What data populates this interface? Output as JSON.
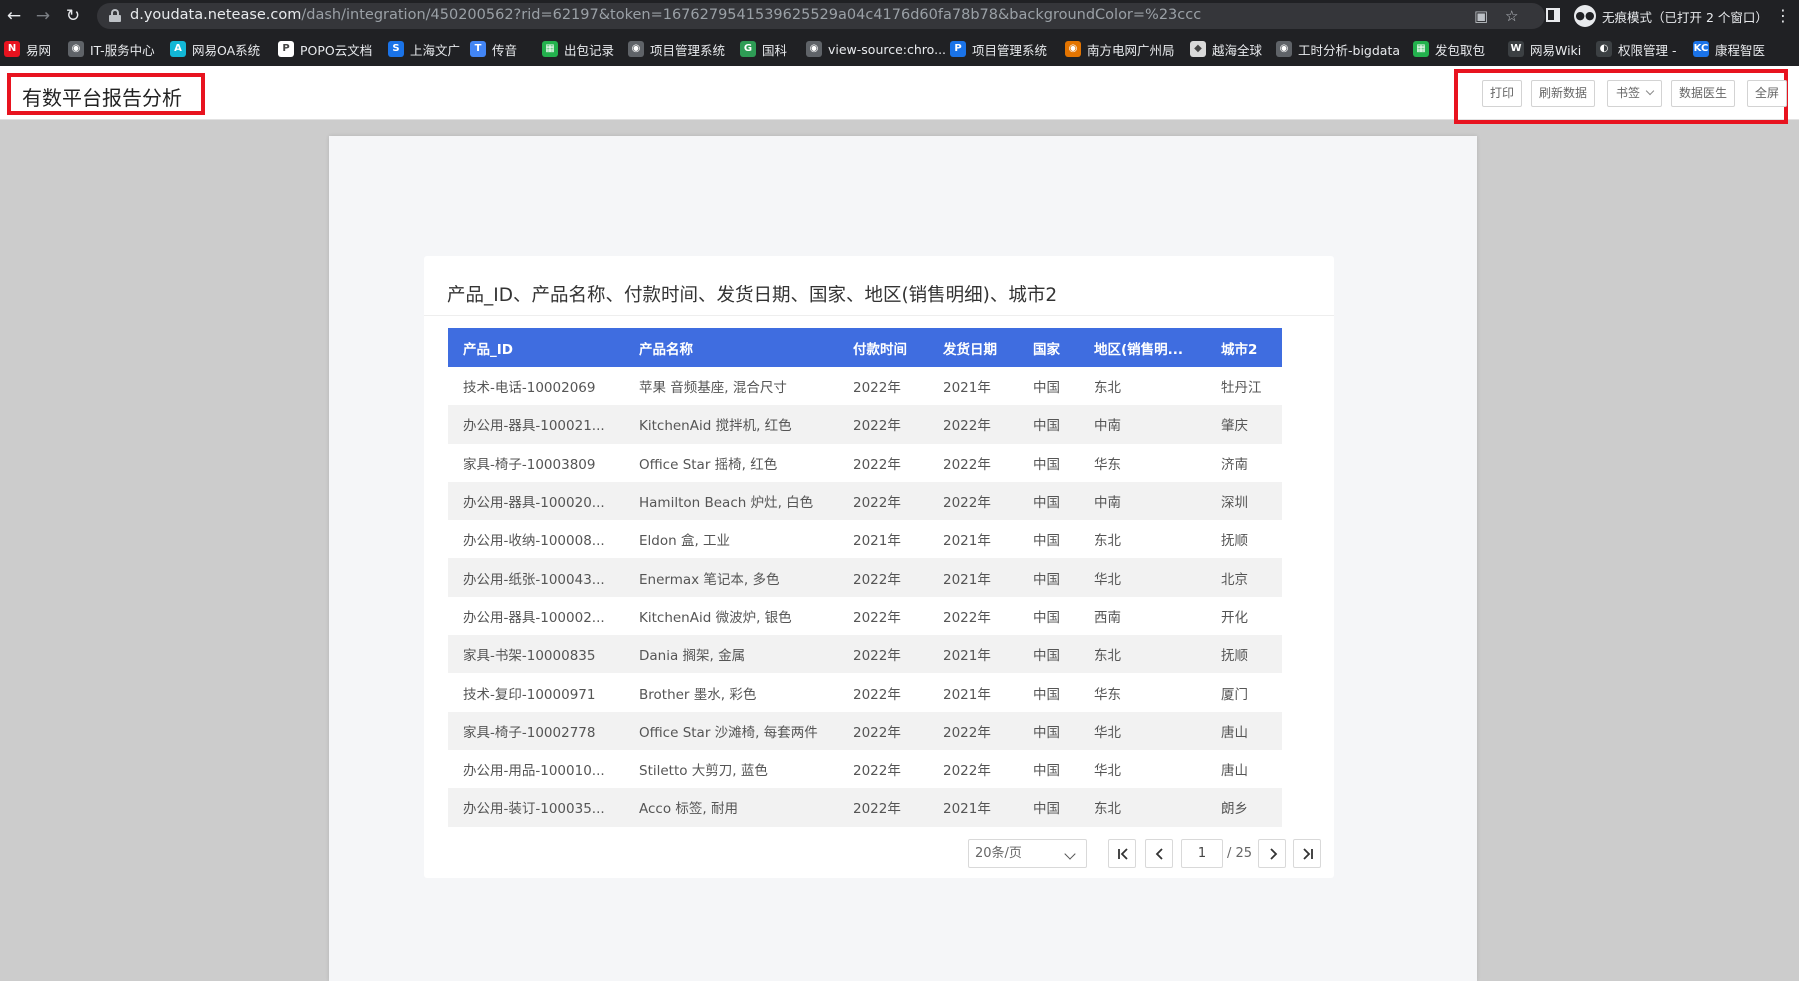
{
  "browser": {
    "url_host": "d.youdata.netease.com",
    "url_path": "/dash/integration/450200562?rid=62197&token=1676279541539625529a04c4176d60fa78b78&backgroundColor=%23ccc",
    "incognito_label": "无痕模式（已打开 2 个窗口）",
    "bookmarks": [
      {
        "label": "易网",
        "icon": "netease-icon",
        "color": "#e8131f",
        "glyph": "N"
      },
      {
        "label": "IT-服务中心",
        "icon": "globe-icon",
        "color": "#5f6368",
        "glyph": "◉"
      },
      {
        "label": "网易OA系统",
        "icon": "oa-icon",
        "color": "#12b7d6",
        "glyph": "A"
      },
      {
        "label": "POPO云文档",
        "icon": "popo-icon",
        "color": "#ffffff",
        "glyph": "P"
      },
      {
        "label": "上海文广",
        "icon": "smg-icon",
        "color": "#1a73e8",
        "glyph": "S"
      },
      {
        "label": "传音",
        "icon": "transsion-icon",
        "color": "#4285f4",
        "glyph": "T"
      },
      {
        "label": "出包记录",
        "icon": "sheet-icon",
        "color": "#23b14d",
        "glyph": "▦"
      },
      {
        "label": "项目管理系统",
        "icon": "globe-icon",
        "color": "#5f6368",
        "glyph": "◉"
      },
      {
        "label": "国科",
        "icon": "guoke-icon",
        "color": "#2e9c55",
        "glyph": "G"
      },
      {
        "label": "view-source:chro...",
        "icon": "globe-icon",
        "color": "#5f6368",
        "glyph": "◉"
      },
      {
        "label": "项目管理系统",
        "icon": "pm-icon",
        "color": "#1a73e8",
        "glyph": "P"
      },
      {
        "label": "南方电网广州局",
        "icon": "csg-icon",
        "color": "#e37400",
        "glyph": "◉"
      },
      {
        "label": "越海全球",
        "icon": "shield-icon",
        "color": "#d9d9d9",
        "glyph": "◆"
      },
      {
        "label": "工时分析-bigdata",
        "icon": "globe-icon",
        "color": "#5f6368",
        "glyph": "◉"
      },
      {
        "label": "发包取包",
        "icon": "sheet-icon",
        "color": "#23b14d",
        "glyph": "▦"
      },
      {
        "label": "网易Wiki",
        "icon": "wiki-icon",
        "color": "#3c4043",
        "glyph": "W"
      },
      {
        "label": "权限管理 -",
        "icon": "perm-icon",
        "color": "#3c4043",
        "glyph": "◐"
      },
      {
        "label": "康程智医",
        "icon": "kc-icon",
        "color": "#1a73e8",
        "glyph": "KC"
      }
    ]
  },
  "header": {
    "title": "有数平台报告分析",
    "buttons": {
      "print": "打印",
      "refresh": "刷新数据",
      "bookmark": "书签",
      "doctor": "数据医生",
      "fullscreen": "全屏"
    }
  },
  "report": {
    "title": "产品_ID、产品名称、付款时间、发货日期、国家、地区(销售明细)、城市2",
    "columns": [
      "产品_ID",
      "产品名称",
      "付款时间",
      "发货日期",
      "国家",
      "地区(销售明...",
      "城市2"
    ],
    "rows": [
      [
        "技术-电话-10002069",
        "苹果 音频基座, 混合尺寸",
        "2022年",
        "2021年",
        "中国",
        "东北",
        "牡丹江"
      ],
      [
        "办公用-器具-100021...",
        "KitchenAid 搅拌机, 红色",
        "2022年",
        "2022年",
        "中国",
        "中南",
        "肇庆"
      ],
      [
        "家具-椅子-10003809",
        "Office Star 摇椅, 红色",
        "2022年",
        "2022年",
        "中国",
        "华东",
        "济南"
      ],
      [
        "办公用-器具-100020...",
        "Hamilton Beach 炉灶, 白色",
        "2022年",
        "2022年",
        "中国",
        "中南",
        "深圳"
      ],
      [
        "办公用-收纳-100008...",
        "Eldon 盒, 工业",
        "2021年",
        "2021年",
        "中国",
        "东北",
        "抚顺"
      ],
      [
        "办公用-纸张-100043...",
        "Enermax 笔记本, 多色",
        "2022年",
        "2021年",
        "中国",
        "华北",
        "北京"
      ],
      [
        "办公用-器具-100002...",
        "KitchenAid 微波炉, 银色",
        "2022年",
        "2022年",
        "中国",
        "西南",
        "开化"
      ],
      [
        "家具-书架-10000835",
        "Dania 搁架, 金属",
        "2022年",
        "2021年",
        "中国",
        "东北",
        "抚顺"
      ],
      [
        "技术-复印-10000971",
        "Brother 墨水, 彩色",
        "2022年",
        "2021年",
        "中国",
        "华东",
        "厦门"
      ],
      [
        "家具-椅子-10002778",
        "Office Star 沙滩椅, 每套两件",
        "2022年",
        "2022年",
        "中国",
        "华北",
        "唐山"
      ],
      [
        "办公用-用品-100010...",
        "Stiletto 大剪刀, 蓝色",
        "2022年",
        "2022年",
        "中国",
        "华北",
        "唐山"
      ],
      [
        "办公用-装订-100035...",
        "Acco 标签, 耐用",
        "2022年",
        "2021年",
        "中国",
        "东北",
        "朗乡"
      ]
    ],
    "pagination": {
      "page_size": "20条/页",
      "current_page": "1",
      "total": "/ 25"
    }
  },
  "colors": {
    "header_blue": "#3f6de0",
    "highlight_red": "#e8131f",
    "background": "#cccccc"
  }
}
